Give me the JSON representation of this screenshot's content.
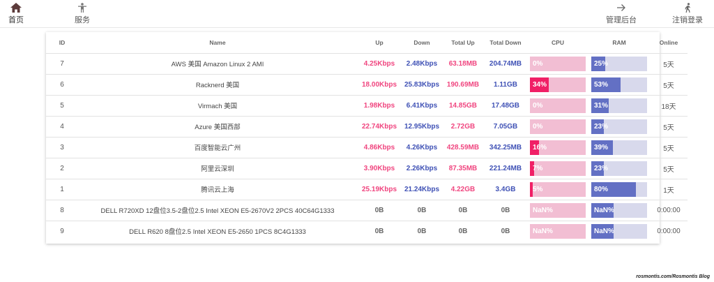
{
  "nav": {
    "home": "首页",
    "services": "服务",
    "admin": "管理后台",
    "logout": "注销登录"
  },
  "table": {
    "headers": [
      "ID",
      "Name",
      "Up",
      "Down",
      "Total Up",
      "Total Down",
      "CPU",
      "RAM",
      "Online"
    ],
    "rows": [
      {
        "id": "7",
        "name": "AWS 美国 Amazon Linux 2 AMI",
        "up": "4.25Kbps",
        "down": "2.48Kbps",
        "total_up": "63.18MB",
        "total_down": "204.74MB",
        "cpu": 0,
        "cpu_label": "0%",
        "ram": 25,
        "ram_label": "25%",
        "online": "5天"
      },
      {
        "id": "6",
        "name": "Racknerd 美国",
        "up": "18.00Kbps",
        "down": "25.83Kbps",
        "total_up": "190.69MB",
        "total_down": "1.11GB",
        "cpu": 34,
        "cpu_label": "34%",
        "ram": 53,
        "ram_label": "53%",
        "online": "5天"
      },
      {
        "id": "5",
        "name": "Virmach 美国",
        "up": "1.98Kbps",
        "down": "6.41Kbps",
        "total_up": "14.85GB",
        "total_down": "17.48GB",
        "cpu": 0,
        "cpu_label": "0%",
        "ram": 31,
        "ram_label": "31%",
        "online": "18天"
      },
      {
        "id": "4",
        "name": "Azure 美国西部",
        "up": "22.74Kbps",
        "down": "12.95Kbps",
        "total_up": "2.72GB",
        "total_down": "7.05GB",
        "cpu": 0,
        "cpu_label": "0%",
        "ram": 23,
        "ram_label": "23%",
        "online": "5天"
      },
      {
        "id": "3",
        "name": "百度智能云广州",
        "up": "4.86Kbps",
        "down": "4.26Kbps",
        "total_up": "428.59MB",
        "total_down": "342.25MB",
        "cpu": 16,
        "cpu_label": "16%",
        "ram": 39,
        "ram_label": "39%",
        "online": "5天"
      },
      {
        "id": "2",
        "name": "阿里云深圳",
        "up": "3.90Kbps",
        "down": "2.26Kbps",
        "total_up": "87.35MB",
        "total_down": "221.24MB",
        "cpu": 7,
        "cpu_label": "7%",
        "ram": 23,
        "ram_label": "23%",
        "online": "5天"
      },
      {
        "id": "1",
        "name": "腾讯云上海",
        "up": "25.19Kbps",
        "down": "21.24Kbps",
        "total_up": "4.22GB",
        "total_down": "3.4GB",
        "cpu": 5,
        "cpu_label": "5%",
        "ram": 80,
        "ram_label": "80%",
        "online": "1天"
      },
      {
        "id": "8",
        "name": "DELL R720XD 12盘位3.5-2盘位2.5 Intel XEON E5-2670V2 2PCS 40C64G1333",
        "up": "0B",
        "down": "0B",
        "total_up": "0B",
        "total_down": "0B",
        "cpu": 0,
        "cpu_label": "NaN%",
        "ram": 40,
        "ram_label": "NaN%",
        "online": "0:00:00"
      },
      {
        "id": "9",
        "name": "DELL R620 8盘位2.5 Intel XEON E5-2650 1PCS 8C4G1333",
        "up": "0B",
        "down": "0B",
        "total_up": "0B",
        "total_down": "0B",
        "cpu": 0,
        "cpu_label": "NaN%",
        "ram": 40,
        "ram_label": "NaN%",
        "online": "0:00:00"
      }
    ]
  },
  "footer": {
    "credit": "rosmontis.com/Rosmontis Blog"
  },
  "icons": {
    "home": "home-icon",
    "services": "person-icon",
    "admin": "arrow-right-icon",
    "logout": "walking-person-icon"
  },
  "colors": {
    "up": "#f0457f",
    "down": "#3f51b5",
    "cpu_fill": "#f01f66",
    "cpu_track": "#f2bed3",
    "ram_fill": "#6370c4",
    "ram_track": "#d8d9ec"
  }
}
